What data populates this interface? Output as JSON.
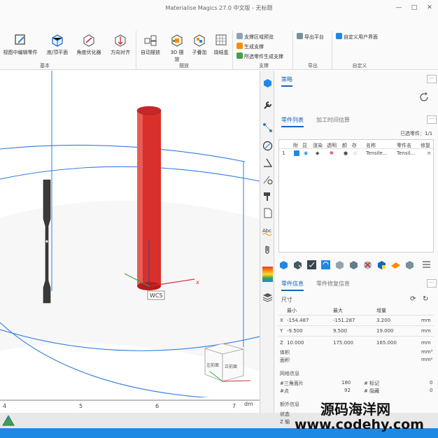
{
  "window": {
    "title": "Materialise Magics 27.0 中文版 - 无标题",
    "minimize": "—",
    "maximize": "□",
    "close": "✕"
  },
  "ribbon": {
    "groups": [
      {
        "label": "基本"
      },
      {
        "label": "摆放"
      },
      {
        "label": "支撑"
      },
      {
        "label": "导出"
      },
      {
        "label": "自定义"
      }
    ],
    "buttons": {
      "edit_in_view": "视图中编辑零件",
      "bottom_top": "底/顶平面",
      "angle_opt": "角度优化器",
      "dir_align": "方向对齐",
      "auto_place": "自动摆放",
      "nest_3d_1": "3D 摆",
      "nest_3d_2": "放",
      "sub_add": "子叠加",
      "sinter_box": "烧结盒",
      "support_preview": "支撑区域预览",
      "gen_support": "生成支撑",
      "gen_support_sel": "所选零件生成支撑",
      "export_platform": "导出平台",
      "custom_ui": "自定义用户界面"
    }
  },
  "viewport": {
    "wcs_label": "WCS",
    "axis_x": "x",
    "cube_front": "正前面",
    "cube_left": "左前面",
    "ruler_ticks": [
      "4",
      "5",
      "6",
      "7"
    ],
    "ruler_unit": "dm"
  },
  "panel": {
    "top_tab": "策略",
    "parts_tabs": [
      "零件列表",
      "加工时间估算"
    ],
    "selected_parts_label": "已选零件：",
    "selected_parts_value": "1/1",
    "table_headers": [
      "附",
      "显",
      "渲染",
      "透明",
      "颜",
      "存",
      "名称",
      "零件名",
      "修复"
    ],
    "table_row": {
      "index": "1",
      "name": "Tensile...",
      "part_name": "Tensil...",
      "last": "n"
    },
    "info_tabs": [
      "零件信息",
      "零件修复信息"
    ],
    "dimensions": {
      "title": "尺寸",
      "col_min": "最小",
      "col_max": "最大",
      "col_delta": "增量",
      "rows": [
        {
          "axis": "X",
          "min": "-154.487",
          "max": "-151.287",
          "delta": "3.200",
          "unit": "mm"
        },
        {
          "axis": "Y",
          "min": "-9.500",
          "max": "9.500",
          "delta": "19.000",
          "unit": "mm"
        },
        {
          "axis": "Z",
          "min": "10.000",
          "max": "175.000",
          "delta": "165.000",
          "unit": "mm"
        }
      ],
      "volume_label": "体积",
      "volume_unit": "mm³",
      "area_label": "面积",
      "area_unit": "mm²"
    },
    "mesh": {
      "title": "网格信息",
      "triangles_label": "#三角面片",
      "triangles_value": "180",
      "points_label": "#点",
      "points_value": "92",
      "marked_label": "# 标记",
      "marked_value": "0",
      "hidden_label": "# 隐藏",
      "hidden_value": "0"
    },
    "extra": {
      "title": "额外信息",
      "status_label": "状态",
      "z_label": "Z 轴"
    }
  },
  "watermark": {
    "line1": "源码海洋网",
    "line2": "www.codehy.com"
  },
  "colors": {
    "accent": "#1565c0",
    "cylinder": "#d9302b",
    "platform": "#2f7de0"
  }
}
